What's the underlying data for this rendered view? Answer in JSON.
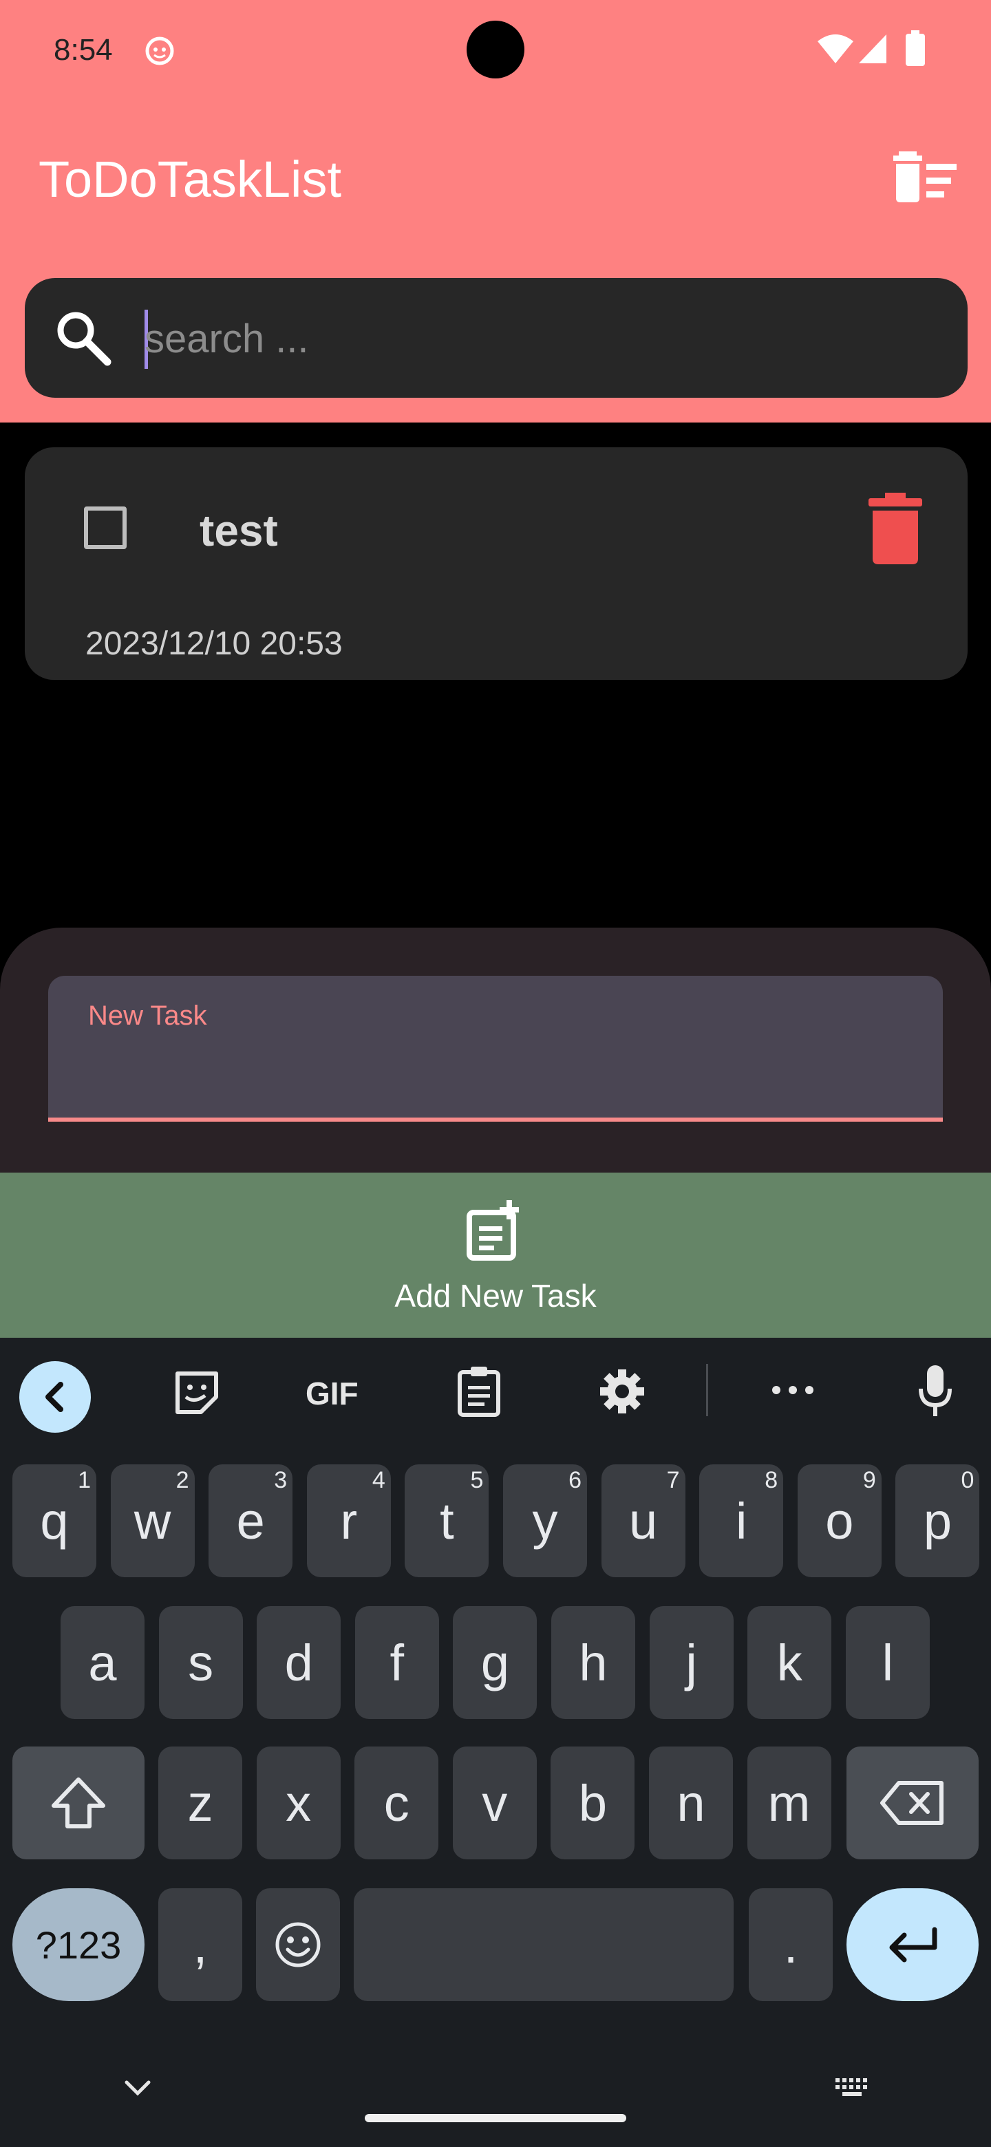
{
  "status_bar": {
    "time": "8:54"
  },
  "app": {
    "title": "ToDoTaskList"
  },
  "search": {
    "placeholder": "search ..."
  },
  "tasks": [
    {
      "title": "test",
      "date": "2023/12/10 20:53",
      "checked": false
    }
  ],
  "new_task": {
    "label": "New Task",
    "value": ""
  },
  "add_button": {
    "label": "Add New Task"
  },
  "keyboard": {
    "toolbar": {
      "gif": "GIF"
    },
    "row1": [
      {
        "k": "q",
        "h": "1"
      },
      {
        "k": "w",
        "h": "2"
      },
      {
        "k": "e",
        "h": "3"
      },
      {
        "k": "r",
        "h": "4"
      },
      {
        "k": "t",
        "h": "5"
      },
      {
        "k": "y",
        "h": "6"
      },
      {
        "k": "u",
        "h": "7"
      },
      {
        "k": "i",
        "h": "8"
      },
      {
        "k": "o",
        "h": "9"
      },
      {
        "k": "p",
        "h": "0"
      }
    ],
    "row2": [
      "a",
      "s",
      "d",
      "f",
      "g",
      "h",
      "j",
      "k",
      "l"
    ],
    "row3": [
      "z",
      "x",
      "c",
      "v",
      "b",
      "n",
      "m"
    ],
    "sym_label": "?123",
    "comma": ",",
    "period": "."
  },
  "colors": {
    "header": "#fe8181",
    "add_button": "#658567",
    "delete_icon": "#ef4f4f"
  }
}
